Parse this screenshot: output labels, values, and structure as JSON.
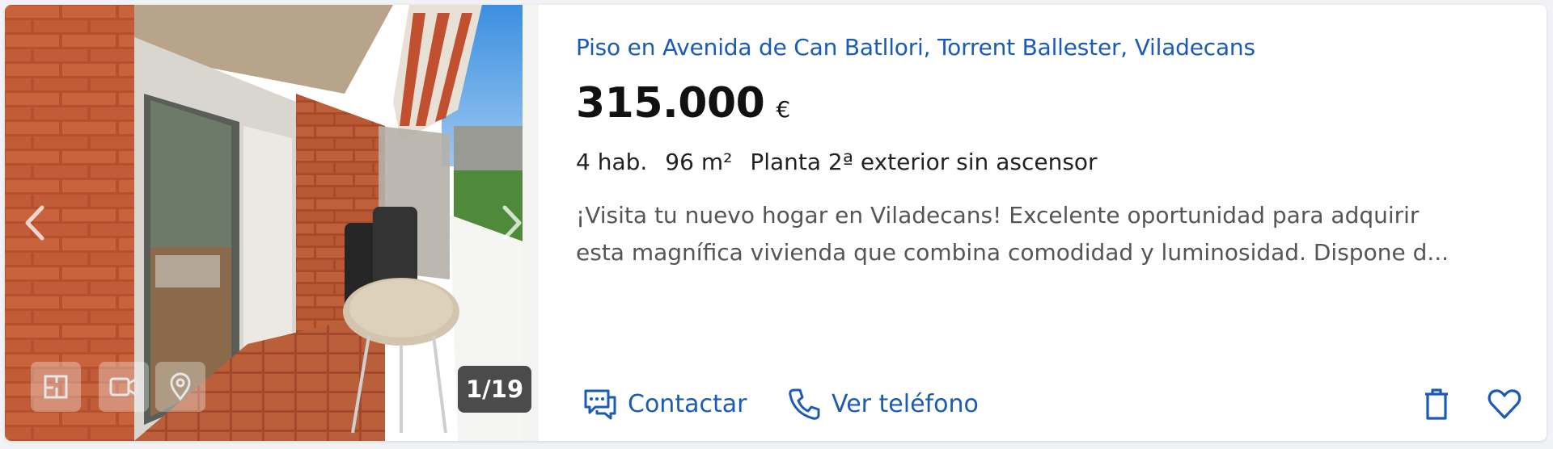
{
  "listing": {
    "title": "Piso en Avenida de Can Batllori, Torrent Ballester, Viladecans",
    "price": "315.000",
    "currency": "€",
    "features": [
      "4 hab.",
      "96 m²",
      "Planta 2ª exterior sin ascensor"
    ],
    "description_lines": [
      "¡Visita tu nuevo hogar en Viladecans! Excelente oportunidad para adquirir",
      "esta magnífica vivienda que combina comodidad y luminosidad. Dispone d..."
    ]
  },
  "gallery": {
    "counter": "1/19",
    "media_buttons": [
      "floor-plan-icon",
      "video-icon",
      "map-pin-icon"
    ]
  },
  "actions": {
    "contact_label": "Contactar",
    "phone_label": "Ver teléfono",
    "icons": [
      "chat-icon",
      "phone-icon",
      "trash-icon",
      "heart-icon"
    ]
  },
  "colors": {
    "link": "#1a5bb8",
    "price": "#111111",
    "text": "#222222",
    "muted": "#555555"
  }
}
